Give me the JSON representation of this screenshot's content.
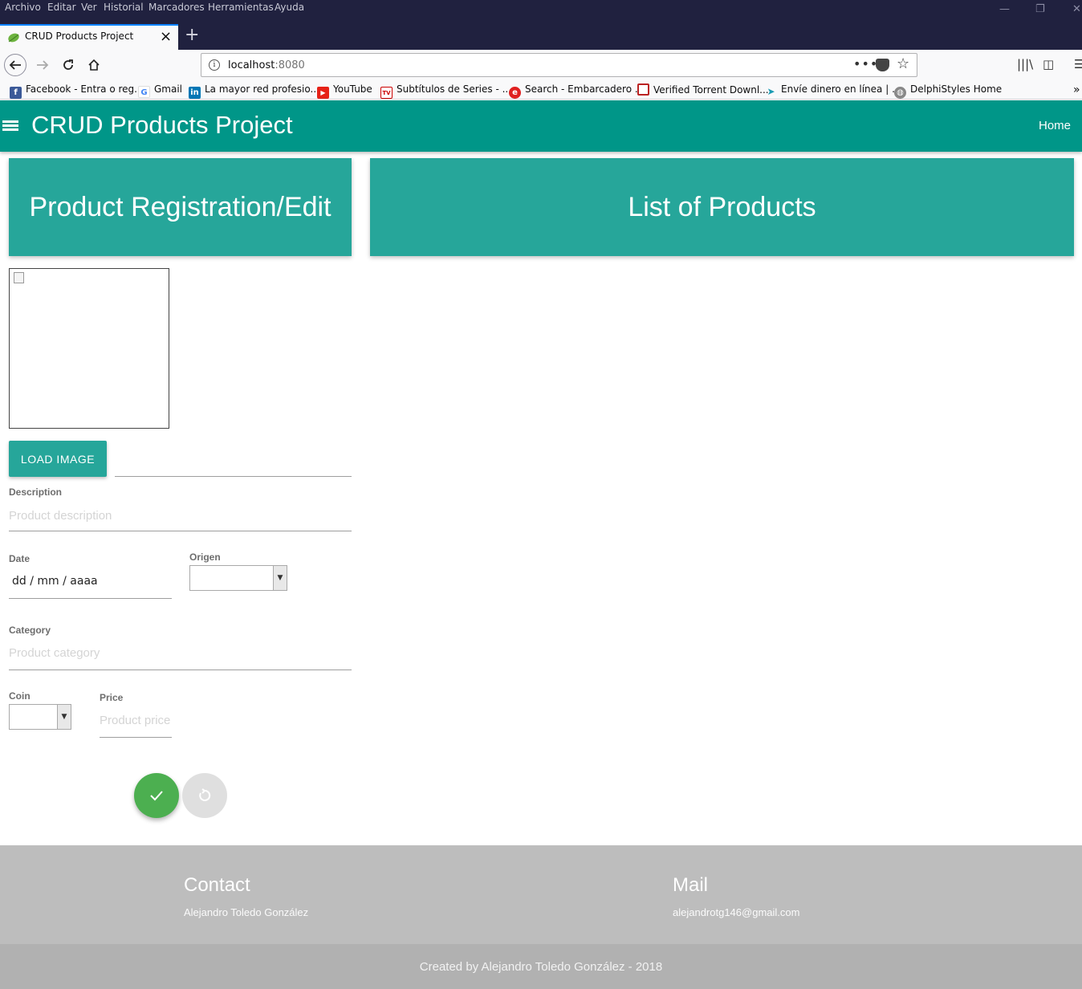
{
  "browser": {
    "menu": [
      "Archivo",
      "Editar",
      "Ver",
      "Historial",
      "Marcadores",
      "Herramientas",
      "Ayuda"
    ],
    "tab_title": "CRUD Products Project",
    "url_host": "localhost",
    "url_port": ":8080",
    "bookmarks": [
      {
        "label": "Facebook - Entra o reg...",
        "icon": "facebook-icon"
      },
      {
        "label": "Gmail",
        "icon": "google-icon"
      },
      {
        "label": "La mayor red profesio...",
        "icon": "linkedin-icon"
      },
      {
        "label": "YouTube",
        "icon": "youtube-icon"
      },
      {
        "label": "Subtítulos de Series - ...",
        "icon": "tv-icon"
      },
      {
        "label": "Search - Embarcadero ...",
        "icon": "embarcadero-icon"
      },
      {
        "label": "Verified Torrent Downl...",
        "icon": "torrent-icon"
      },
      {
        "label": "Envíe dinero en línea | ...",
        "icon": "money-transfer-icon"
      },
      {
        "label": "DelphiStyles Home",
        "icon": "globe-icon"
      }
    ]
  },
  "app": {
    "brand": "CRUD Products Project",
    "nav_home": "Home",
    "accent": "#009688"
  },
  "panels": {
    "registration_title": "Product Registration/Edit",
    "list_title": "List of Products"
  },
  "form": {
    "load_image_label": "LOAD IMAGE",
    "description_label": "Description",
    "description_placeholder": "Product description",
    "date_label": "Date",
    "date_value": "dd / mm / aaaa",
    "origin_label": "Origen",
    "category_label": "Category",
    "category_placeholder": "Product category",
    "coin_label": "Coin",
    "price_label": "Price",
    "price_placeholder": "Product price"
  },
  "footer": {
    "contact_title": "Contact",
    "contact_name": "Alejandro Toledo González",
    "mail_title": "Mail",
    "mail_address": "alejandrotg146@gmail.com",
    "copyright": "Created by Alejandro Toledo González - 2018"
  }
}
